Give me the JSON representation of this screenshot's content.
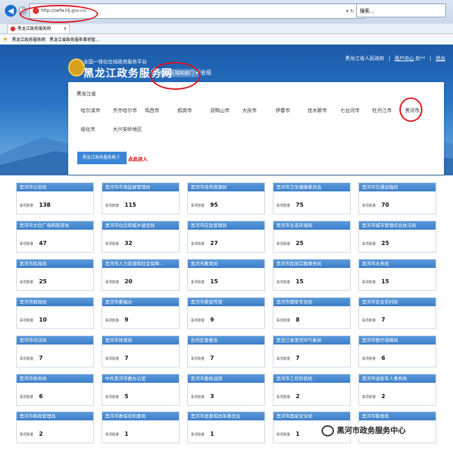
{
  "browser": {
    "url": "http://zwfw.hlj.gov.cn/",
    "search_placeholder": "搜索...",
    "tab_title": "黑龙江政务服务网",
    "favorites": [
      "黑龙江政务服务网",
      "黑龙江省政务服务事项管..."
    ]
  },
  "header": {
    "subtitle": "全国一体化在线政务服务平台",
    "title": "黑龙江政务服务网",
    "switch_label": "切换区域和部门",
    "level_label": "省级",
    "gov_link": "黑龙江省人民政府",
    "user_center": "用户中心",
    "user_name": "赵**",
    "logout": "退出"
  },
  "region_panel": {
    "province": "黑龙江省",
    "cities": [
      "哈尔滨市",
      "齐齐哈尔市",
      "鸡西市",
      "鹤岗市",
      "双鸭山市",
      "大庆市",
      "伊春市",
      "佳木斯市",
      "七台河市",
      "牡丹江市",
      "黑河市",
      "绥化市",
      "大兴安岭地区"
    ],
    "enter_button": "黑龙江政务服务网 》",
    "enter_link": "点此进入"
  },
  "count_label": "事项数量",
  "departments": [
    {
      "name": "黑河市公安局",
      "count": "138"
    },
    {
      "name": "黑河市市场监督管理局",
      "count": "115"
    },
    {
      "name": "黑河市自然资源局",
      "count": "95"
    },
    {
      "name": "黑河市卫生健康委员会",
      "count": "75"
    },
    {
      "name": "黑河市交通运输局",
      "count": "70"
    },
    {
      "name": "黑河市文化广电和旅游局",
      "count": "47"
    },
    {
      "name": "黑河市住房和城乡建设局",
      "count": "32"
    },
    {
      "name": "黑河市应急管理局",
      "count": "27"
    },
    {
      "name": "黑河市生态环境局",
      "count": "25"
    },
    {
      "name": "黑河市城市管理综合执法局",
      "count": "25"
    },
    {
      "name": "黑河市民政局",
      "count": "25"
    },
    {
      "name": "黑河市人力资源和社会保障...",
      "count": "20"
    },
    {
      "name": "黑河市教育局",
      "count": "15"
    },
    {
      "name": "黑河市民族宗教事务局",
      "count": "15"
    },
    {
      "name": "黑河市水务局",
      "count": "15"
    },
    {
      "name": "黑河市财政局",
      "count": "10"
    },
    {
      "name": "黑河市委编办",
      "count": "9"
    },
    {
      "name": "黑河市委宣传部",
      "count": "9"
    },
    {
      "name": "黑河市烟草专卖局",
      "count": "8"
    },
    {
      "name": "黑河市农业农村局",
      "count": "7"
    },
    {
      "name": "黑河市司法局",
      "count": "7"
    },
    {
      "name": "黑河市体育局",
      "count": "7"
    },
    {
      "name": "合作区管委会",
      "count": "7"
    },
    {
      "name": "黑龙江省黑河市气象局",
      "count": "7"
    },
    {
      "name": "黑河市医疗保障局",
      "count": "6"
    },
    {
      "name": "黑河市商务局",
      "count": "6"
    },
    {
      "name": "中共黑河市委办公室",
      "count": "5"
    },
    {
      "name": "黑河市委统战部",
      "count": "3"
    },
    {
      "name": "黑河市工信科技局",
      "count": "2"
    },
    {
      "name": "黑河市退役军人事务局",
      "count": "2"
    },
    {
      "name": "黑河市邮政管理局",
      "count": "2"
    },
    {
      "name": "黑河市委保密机要局",
      "count": "1"
    },
    {
      "name": "黑河市发展和改革委员会",
      "count": "1"
    },
    {
      "name": "黑河市国家安全局",
      "count": "1"
    },
    {
      "name": "黑河市粮食局",
      "count": "1"
    }
  ],
  "watermark": "黑河市政务服务中心"
}
